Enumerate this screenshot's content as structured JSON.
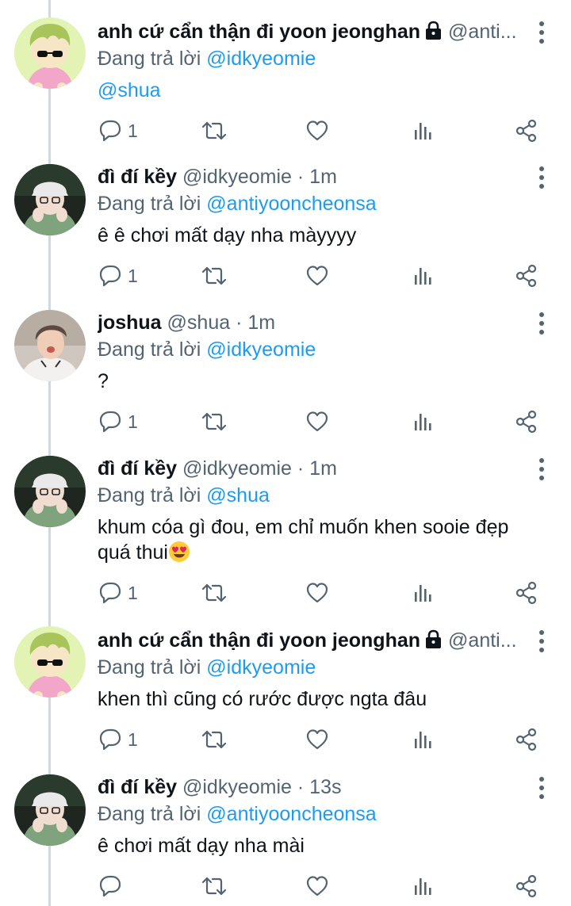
{
  "reply_prefix": "Đang trả lời",
  "tweets": [
    {
      "author": "anh cứ cẩn thận đi yoon jeonghan",
      "handle": "@anti...",
      "time": "",
      "locked": true,
      "replying_to": "@idkyeomie",
      "text": "@shua",
      "reply_count": "1",
      "avatar": "green-character-avatar"
    },
    {
      "author": "đì đí kềy",
      "handle": "@idkyeomie",
      "time": "· 1m",
      "locked": false,
      "replying_to": "@antiyooncheonsa",
      "text": "ê ê chơi mất dạy nha màyyyy",
      "reply_count": "1",
      "avatar": "person-hat-avatar"
    },
    {
      "author": "joshua",
      "handle": "@shua",
      "time": "· 1m",
      "locked": false,
      "replying_to": "@idkyeomie",
      "text": "?",
      "reply_count": "1",
      "avatar": "person-photo-avatar"
    },
    {
      "author": "đì đí kềy",
      "handle": "@idkyeomie",
      "time": "· 1m",
      "locked": false,
      "replying_to": "@shua",
      "text_line1": "khum cóa gì đou, em chỉ muốn khen sooie đẹp",
      "text_line2": "quá thui",
      "reply_count": "1",
      "avatar": "person-hat-avatar"
    },
    {
      "author": "anh cứ cẩn thận đi yoon jeonghan",
      "handle": "@anti...",
      "time": "",
      "locked": true,
      "replying_to": "@idkyeomie",
      "text": "khen thì cũng có rước được ngta đâu",
      "reply_count": "1",
      "avatar": "green-character-avatar"
    },
    {
      "author": "đì đí kềy",
      "handle": "@idkyeomie",
      "time": "· 13s",
      "locked": false,
      "replying_to": "@antiyooncheonsa",
      "text": "ê chơi mất dạy nha mài",
      "reply_count": "",
      "avatar": "person-hat-avatar"
    }
  ],
  "icons": {
    "reply": "reply-icon",
    "retweet": "retweet-icon",
    "like": "like-icon",
    "views": "views-icon",
    "share": "share-icon",
    "more": "more-icon",
    "lock": "lock-icon",
    "emoji": "heart-eyes-emoji"
  },
  "colors": {
    "link": "#1d9bf0",
    "secondary": "#536471",
    "thread_line": "#cfd9de"
  }
}
